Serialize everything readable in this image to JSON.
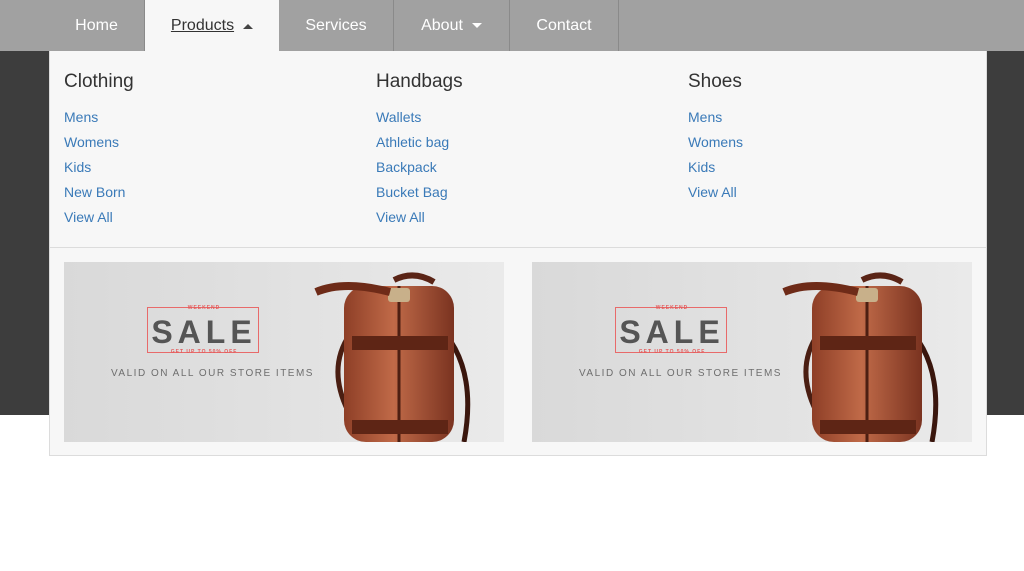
{
  "nav": {
    "items": [
      {
        "label": "Home"
      },
      {
        "label": "Products"
      },
      {
        "label": "Services"
      },
      {
        "label": "About"
      },
      {
        "label": "Contact"
      }
    ]
  },
  "mega": {
    "columns": [
      {
        "title": "Clothing",
        "links": [
          "Mens",
          "Womens",
          "Kids",
          "New Born",
          "View All"
        ]
      },
      {
        "title": "Handbags",
        "links": [
          "Wallets",
          "Athletic bag",
          "Backpack",
          "Bucket Bag",
          "View All"
        ]
      },
      {
        "title": "Shoes",
        "links": [
          "Mens",
          "Womens",
          "Kids",
          "View All"
        ]
      }
    ],
    "banners": [
      {
        "top_text": "WEEKEND",
        "headline": "SALE",
        "subline": "GET UP TO 50% OFF",
        "tagline": "VALID ON ALL OUR STORE ITEMS"
      },
      {
        "top_text": "WEEKEND",
        "headline": "SALE",
        "subline": "GET UP TO 50% OFF",
        "tagline": "VALID ON ALL OUR STORE ITEMS"
      }
    ]
  },
  "colors": {
    "navbar": "#a1a1a1",
    "link": "#3a7ab8",
    "hero": "#3d3d3d",
    "dropdown": "#f7f7f7"
  }
}
